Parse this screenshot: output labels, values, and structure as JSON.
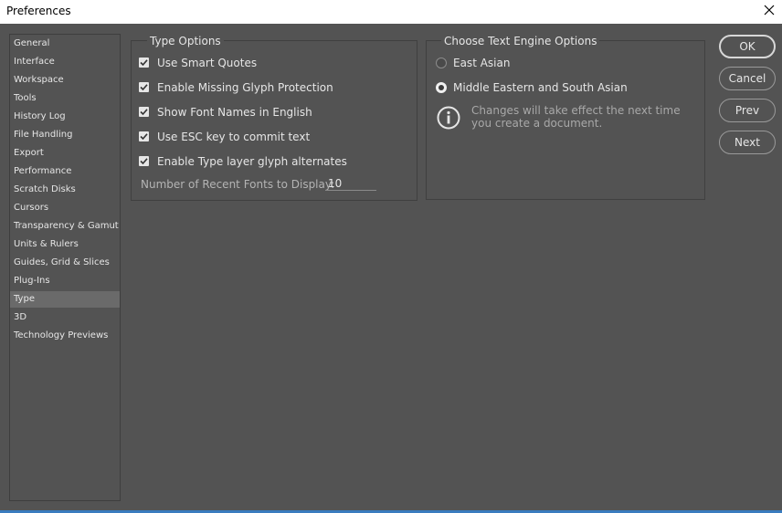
{
  "window": {
    "title": "Preferences",
    "close_icon": "close-icon"
  },
  "sidebar": {
    "items": [
      {
        "label": "General"
      },
      {
        "label": "Interface"
      },
      {
        "label": "Workspace"
      },
      {
        "label": "Tools"
      },
      {
        "label": "History Log"
      },
      {
        "label": "File Handling"
      },
      {
        "label": "Export"
      },
      {
        "label": "Performance"
      },
      {
        "label": "Scratch Disks"
      },
      {
        "label": "Cursors"
      },
      {
        "label": "Transparency & Gamut"
      },
      {
        "label": "Units & Rulers"
      },
      {
        "label": "Guides, Grid & Slices"
      },
      {
        "label": "Plug-Ins"
      },
      {
        "label": "Type",
        "selected": true
      },
      {
        "label": "3D"
      },
      {
        "label": "Technology Previews"
      }
    ]
  },
  "type_options": {
    "title": "Type Options",
    "checkboxes": [
      {
        "label": "Use Smart Quotes",
        "checked": true
      },
      {
        "label": "Enable Missing Glyph Protection",
        "checked": true
      },
      {
        "label": "Show Font Names in English",
        "checked": true
      },
      {
        "label": "Use ESC key to commit text",
        "checked": true
      },
      {
        "label": "Enable Type layer glyph alternates",
        "checked": true
      }
    ],
    "recent_fonts_label": "Number of Recent Fonts to Display:",
    "recent_fonts_value": "10"
  },
  "text_engine": {
    "title": "Choose Text Engine Options",
    "options": [
      {
        "label": "East Asian",
        "selected": false
      },
      {
        "label": "Middle Eastern and South Asian",
        "selected": true
      }
    ],
    "info_icon": "info-icon",
    "info_line1": "Changes will take effect the next time",
    "info_line2": "you create a document."
  },
  "buttons": {
    "ok": "OK",
    "cancel": "Cancel",
    "prev": "Prev",
    "next": "Next"
  },
  "colors": {
    "background": "#535353",
    "text": "#e6e6e6",
    "selected_item": "#6a6a6a",
    "taskbar_accent": "#3a7cbf"
  }
}
